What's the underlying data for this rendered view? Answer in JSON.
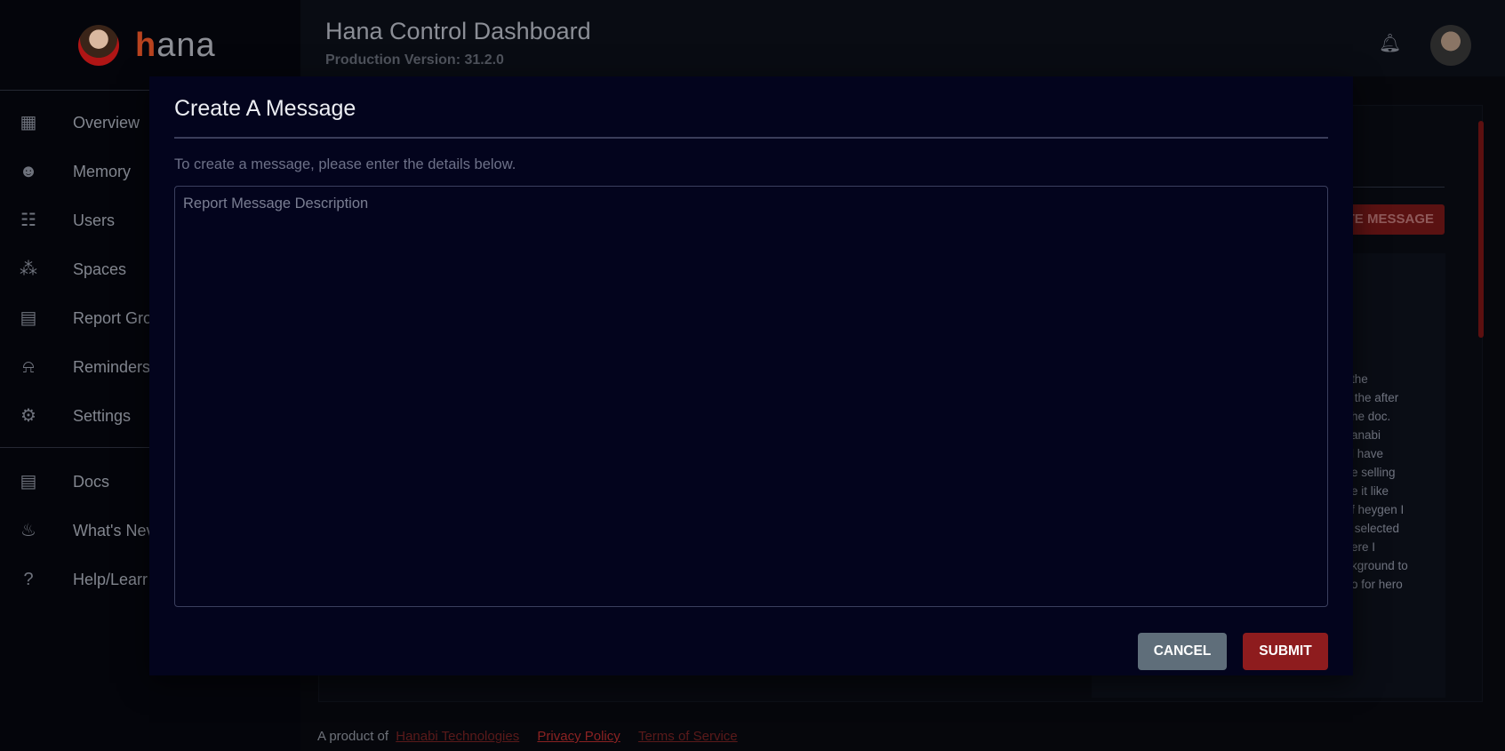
{
  "sidebar": {
    "brand": {
      "letter": "h",
      "rest": "ana"
    },
    "items": [
      {
        "label": "Overview",
        "icon": "dashboard-icon"
      },
      {
        "label": "Memory",
        "icon": "brain-head-icon"
      },
      {
        "label": "Users",
        "icon": "group-icon"
      },
      {
        "label": "Spaces",
        "icon": "workspaces-icon"
      },
      {
        "label": "Report Gro",
        "icon": "report-icon"
      },
      {
        "label": "Reminders",
        "icon": "alarm-bell-icon"
      },
      {
        "label": "Settings",
        "icon": "gear-icon"
      }
    ],
    "secondary": [
      {
        "label": "Docs",
        "icon": "document-icon"
      },
      {
        "label": "What's Nev",
        "icon": "fire-icon"
      },
      {
        "label": "Help/Learr",
        "icon": "help-icon"
      }
    ]
  },
  "header": {
    "title": "Hana Control Dashboard",
    "version": "Production Version: 31.2.0"
  },
  "background": {
    "create_button": "TE MESSAGE",
    "text_fragments": "the\n the after\nhe doc.\nanabi\nl have\ne selling\ne it like\nf heygen I\n selected\nere I\nkground to\no for hero"
  },
  "footer": {
    "prefix": "A product of",
    "company": "Hanabi Technologies",
    "privacy": "Privacy Policy",
    "terms": "Terms of Service"
  },
  "modal": {
    "title": "Create A Message",
    "description": "To create a message, please enter the details below.",
    "textarea": {
      "placeholder": "Report Message Description",
      "value": ""
    },
    "cancel": "CANCEL",
    "submit": "SUBMIT"
  },
  "colors": {
    "accent": "#8e1c1e",
    "cancel": "#5f6e7a",
    "modal_bg": "#03041d"
  }
}
